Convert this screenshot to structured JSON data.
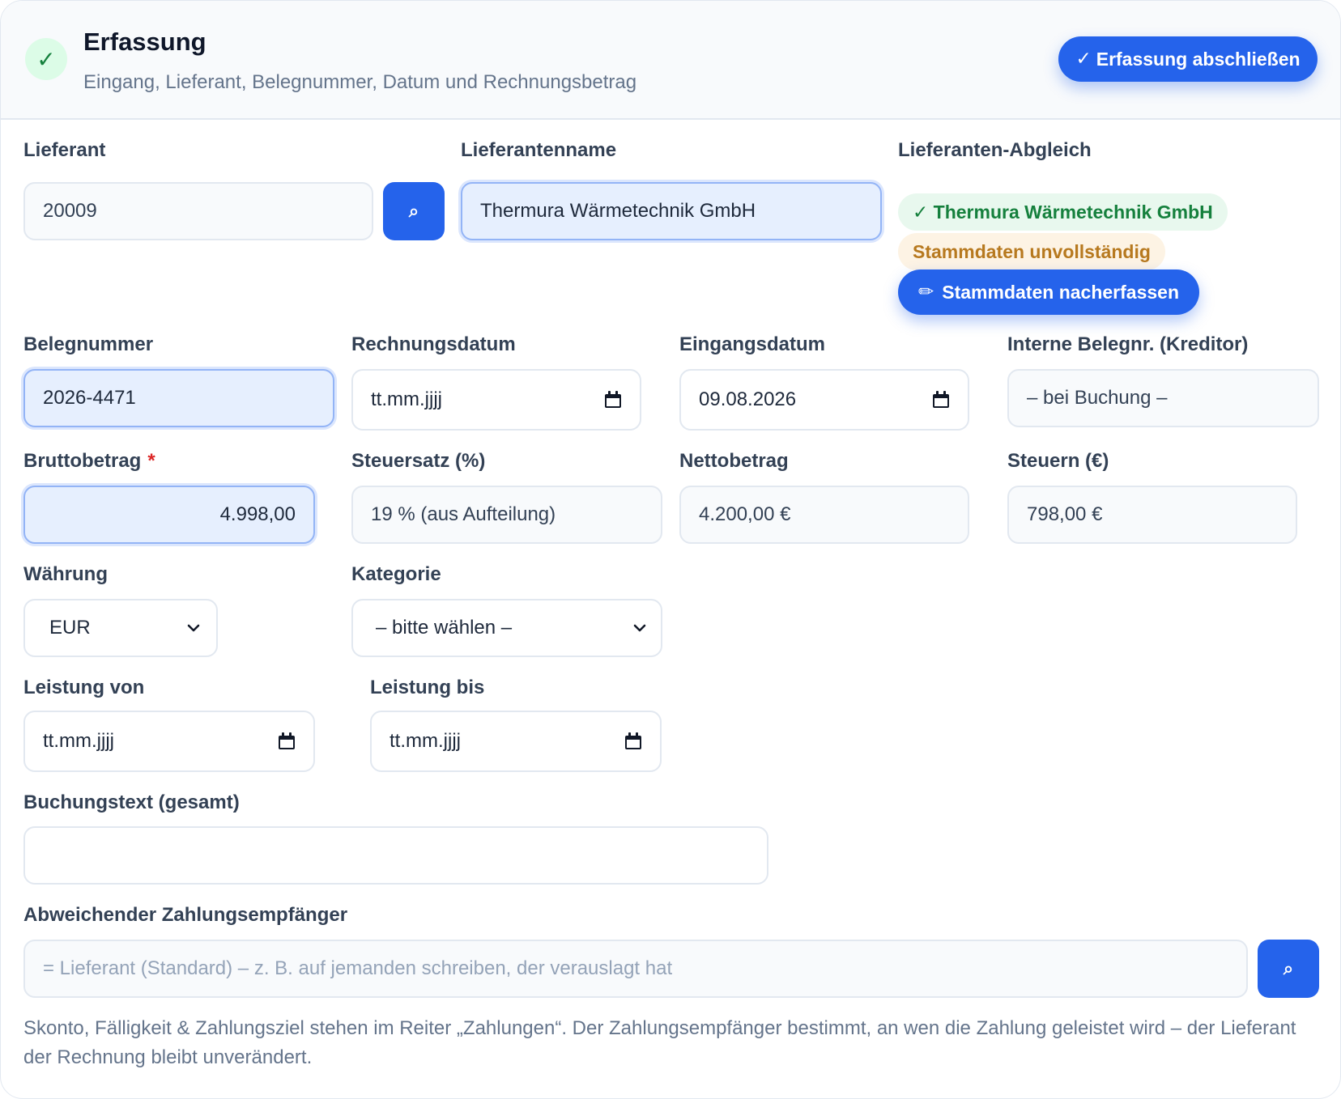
{
  "header": {
    "check_icon": "✓",
    "title": "Erfassung",
    "subtitle": "Eingang, Lieferant, Belegnummer, Datum und Rechnungsbetrag",
    "finish_icon": "✓",
    "finish_label": "Erfassung abschließen"
  },
  "supplier": {
    "label": "Lieferant",
    "value": "20009",
    "search_icon": "⌕"
  },
  "supplier_name": {
    "label": "Lieferantenname",
    "value": "Thermura Wärmetechnik GmbH"
  },
  "match": {
    "label": "Lieferanten-Abgleich",
    "ok_badge": "✓ Thermura Wärmetechnik GmbH",
    "warn_badge": "Stammdaten unvollständig",
    "edit_icon": "✏",
    "edit_label": "Stammdaten nacherfassen"
  },
  "doc_number": {
    "label": "Belegnummer",
    "value": "2026-4471"
  },
  "invoice_date": {
    "label": "Rechnungsdatum",
    "value": "tt.mm.jjjj"
  },
  "receipt_date": {
    "label": "Eingangsdatum",
    "value": "09.08.2026"
  },
  "internal_no": {
    "label": "Interne Belegnr. (Kreditor)",
    "value": "– bei Buchung –"
  },
  "gross": {
    "label": "Bruttobetrag",
    "required": "*",
    "value": "4.998,00"
  },
  "tax_rate": {
    "label": "Steuersatz (%)",
    "value": "19 % (aus Aufteilung)"
  },
  "net": {
    "label": "Nettobetrag",
    "value": "4.200,00 €"
  },
  "tax": {
    "label": "Steuern (€)",
    "value": "798,00 €"
  },
  "currency": {
    "label": "Währung",
    "selected": "EUR"
  },
  "category": {
    "label": "Kategorie",
    "selected": "– bitte wählen –"
  },
  "service_from": {
    "label": "Leistung von",
    "value": "tt.mm.jjjj"
  },
  "service_to": {
    "label": "Leistung bis",
    "value": "tt.mm.jjjj"
  },
  "booking_text": {
    "label": "Buchungstext (gesamt)",
    "value": ""
  },
  "payee": {
    "label": "Abweichender Zahlungsempfänger",
    "placeholder": "= Lieferant (Standard) – z. B. auf jemanden schreiben, der verauslagt hat",
    "search_icon": "⌕"
  },
  "note": "Skonto, Fälligkeit & Zahlungsziel stehen im Reiter „Zahlungen“. Der Zahlungsempfänger bestimmt, an wen die Zahlung geleistet wird – der Lieferant der Rechnung bleibt unverändert.",
  "colors": {
    "accent": "#2563eb",
    "success": "#15803d",
    "warning": "#b7791f",
    "required": "#dc2626"
  }
}
